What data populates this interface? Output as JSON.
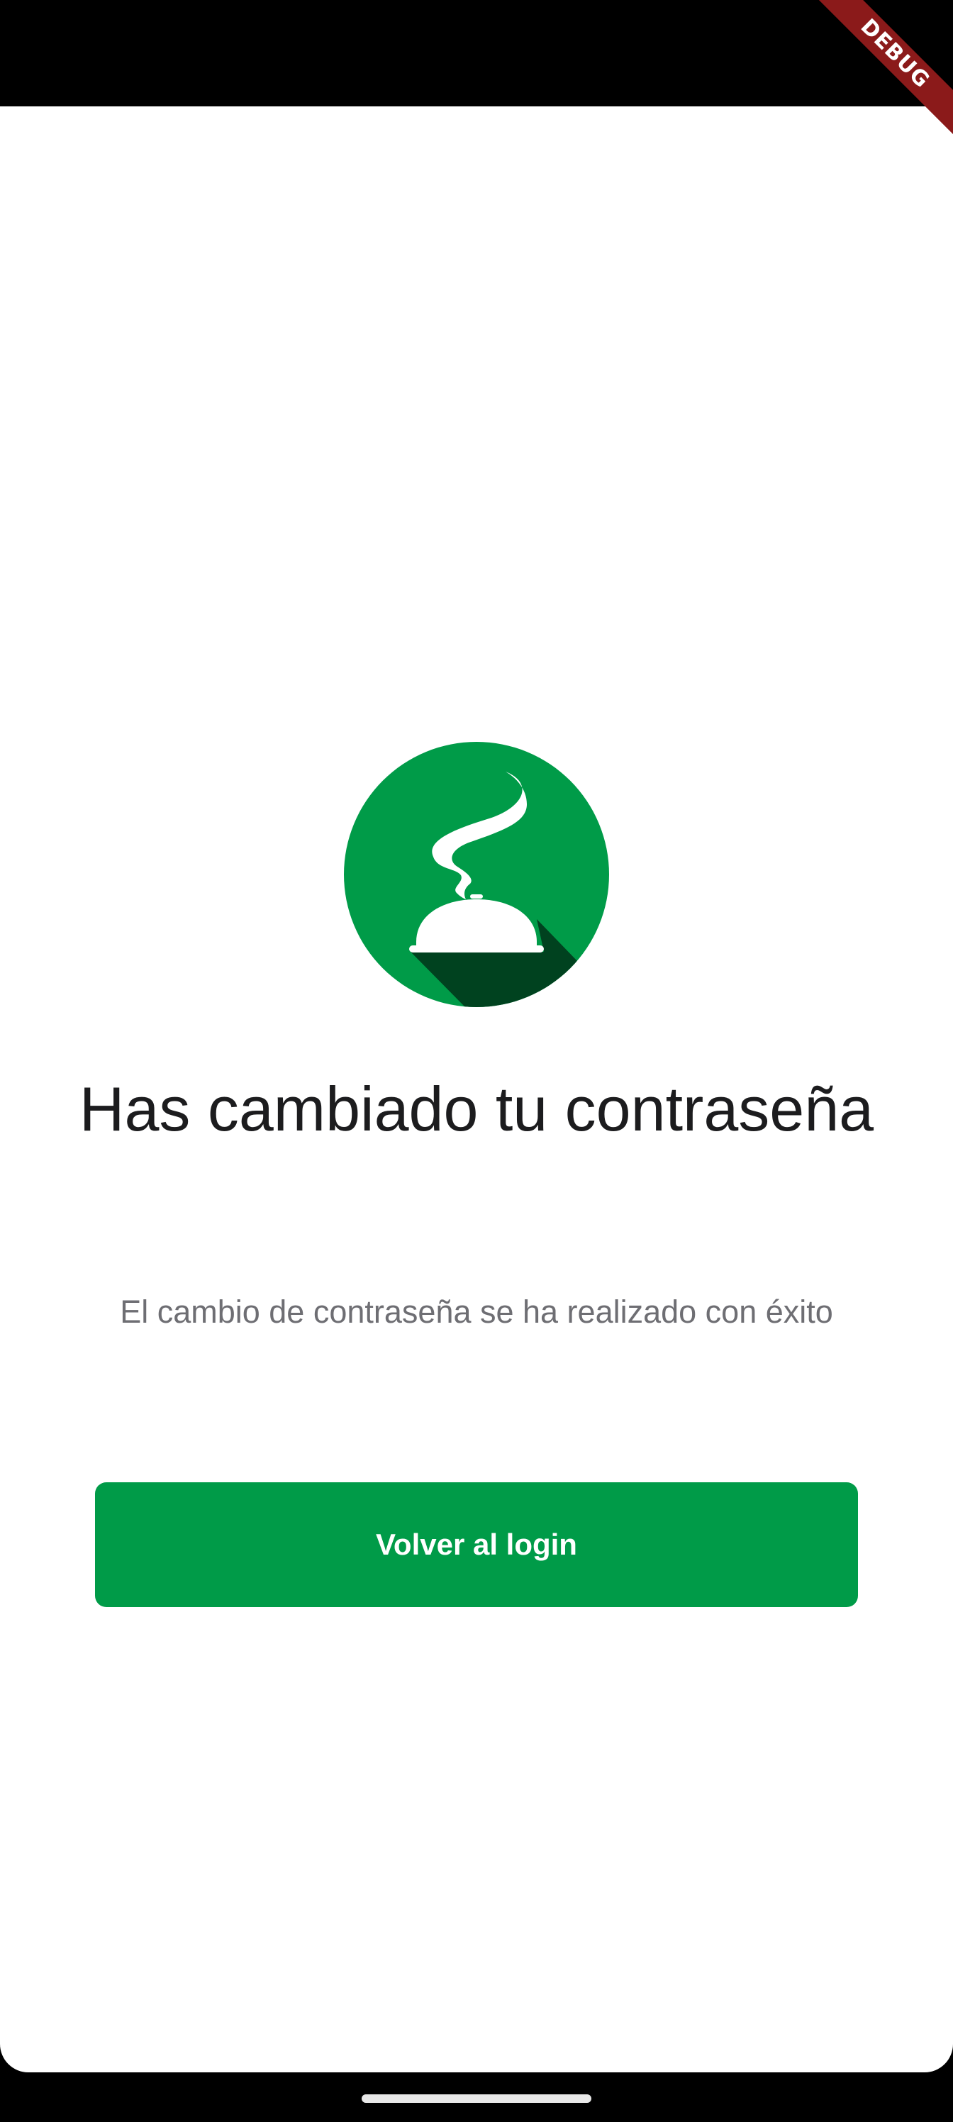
{
  "debug_banner": "DEBUG",
  "screen": {
    "title": "Has cambiado tu contraseña",
    "subtitle": "El cambio de contraseña se ha realizado con éxito",
    "button_label": "Volver al login"
  },
  "logo": {
    "icon": "food-cloche-icon",
    "primary_color": "#009b48",
    "shadow_color": "#00421f"
  },
  "colors": {
    "accent": "#009b48",
    "title_text": "#1c1c1e",
    "body_text": "#6e6e73"
  }
}
